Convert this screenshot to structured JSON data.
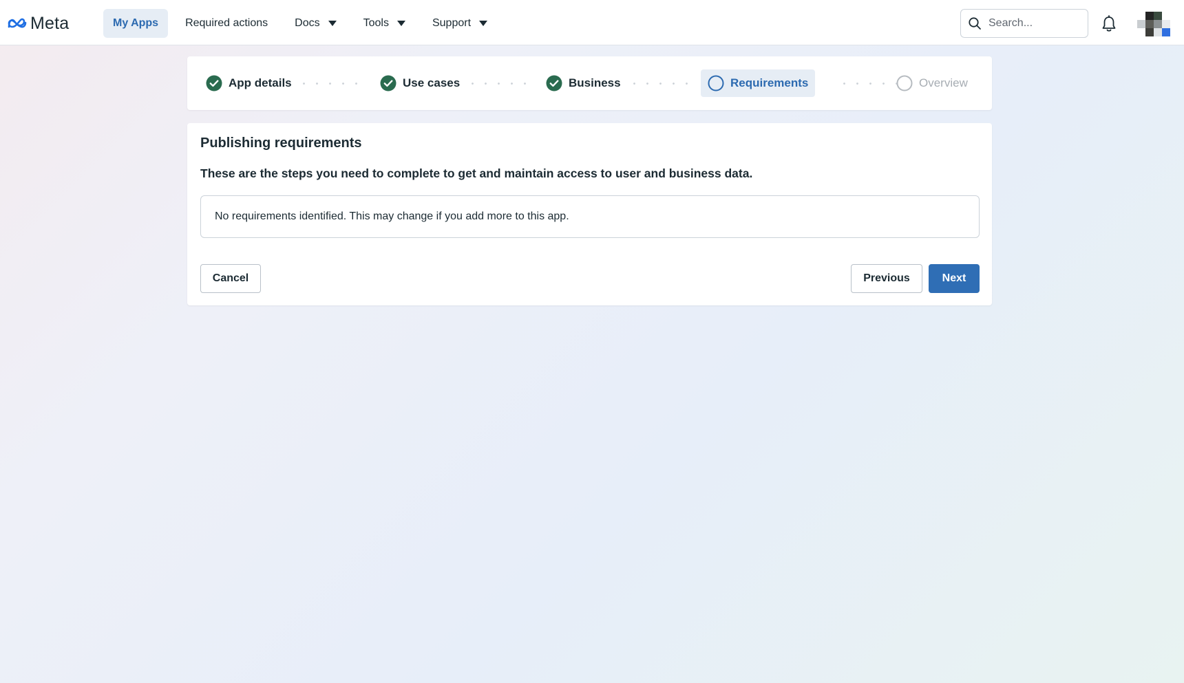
{
  "header": {
    "brand": "Meta",
    "nav": [
      {
        "label": "My Apps",
        "active": true,
        "dropdown": false
      },
      {
        "label": "Required actions",
        "active": false,
        "dropdown": false
      },
      {
        "label": "Docs",
        "active": false,
        "dropdown": true
      },
      {
        "label": "Tools",
        "active": false,
        "dropdown": true
      },
      {
        "label": "Support",
        "active": false,
        "dropdown": true
      }
    ],
    "search": {
      "placeholder": "Search...",
      "value": "",
      "icon": "search-icon"
    },
    "notifications_icon": "bell-icon",
    "avatar_icon": "pixelated-avatar"
  },
  "stepper": {
    "steps": [
      {
        "label": "App details",
        "status": "complete",
        "icon": "check-circle-icon"
      },
      {
        "label": "Use cases",
        "status": "complete",
        "icon": "check-circle-icon"
      },
      {
        "label": "Business",
        "status": "complete",
        "icon": "check-circle-icon"
      },
      {
        "label": "Requirements",
        "status": "current",
        "icon": "circle-outline-icon"
      },
      {
        "label": "Overview",
        "status": "pending",
        "icon": "circle-outline-icon"
      }
    ]
  },
  "main": {
    "title": "Publishing requirements",
    "subtitle": "These are the steps you need to complete to get and maintain access to user and business data.",
    "notice": "No requirements identified. This may change if you add more to this app.",
    "buttons": {
      "cancel": "Cancel",
      "previous": "Previous",
      "next": "Next"
    }
  },
  "colors": {
    "accent": "#2f6eb5",
    "active_nav_bg": "#e6edf5",
    "active_text": "#2c6ab0",
    "complete_green": "#2a6b4f",
    "text": "#1c2b33",
    "muted": "#a7adb3"
  }
}
